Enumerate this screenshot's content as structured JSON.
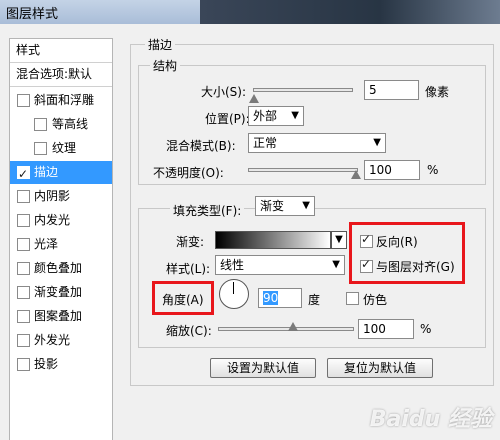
{
  "window": {
    "title": "图层样式"
  },
  "sidebar": {
    "header": "样式",
    "blend_options": "混合选项:默认",
    "items": [
      {
        "label": "斜面和浮雕",
        "checked": false
      },
      {
        "label": "等高线",
        "checked": false
      },
      {
        "label": "纹理",
        "checked": false
      },
      {
        "label": "描边",
        "checked": true,
        "selected": true
      },
      {
        "label": "内阴影",
        "checked": false
      },
      {
        "label": "内发光",
        "checked": false
      },
      {
        "label": "光泽",
        "checked": false
      },
      {
        "label": "颜色叠加",
        "checked": false
      },
      {
        "label": "渐变叠加",
        "checked": false
      },
      {
        "label": "图案叠加",
        "checked": false
      },
      {
        "label": "外发光",
        "checked": false
      },
      {
        "label": "投影",
        "checked": false
      }
    ]
  },
  "stroke": {
    "section_title": "描边",
    "structure_title": "结构",
    "size_label": "大小(S):",
    "size_value": "5",
    "size_unit": "像素",
    "position_label": "位置(P):",
    "position_value": "外部",
    "blend_mode_label": "混合模式(B):",
    "blend_mode_value": "正常",
    "opacity_label": "不透明度(O):",
    "opacity_value": "100",
    "opacity_unit": "%",
    "fill_type_label": "填充类型(F):",
    "fill_type_value": "渐变",
    "gradient_label": "渐变:",
    "reverse_label": "反向(R)",
    "reverse_checked": true,
    "style_label": "样式(L):",
    "style_value": "线性",
    "align_label": "与图层对齐(G)",
    "align_checked": true,
    "angle_label": "角度(A)",
    "angle_value": "90",
    "angle_unit": "度",
    "dither_label": "仿色",
    "dither_checked": false,
    "scale_label": "缩放(C):",
    "scale_value": "100",
    "scale_unit": "%"
  },
  "buttons": {
    "make_default": "设置为默认值",
    "reset_default": "复位为默认值"
  },
  "watermark": "Baidu 经验",
  "colors": {
    "selection": "#3399ff",
    "highlight_box": "#e8161b"
  }
}
